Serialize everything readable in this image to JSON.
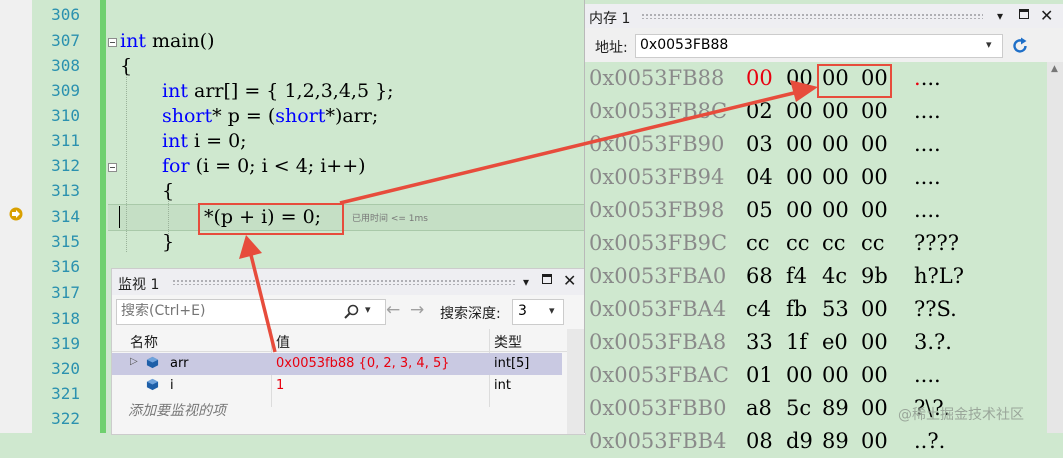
{
  "editor": {
    "line_numbers": [
      "306",
      "307",
      "308",
      "309",
      "310",
      "311",
      "312",
      "313",
      "314",
      "315",
      "316",
      "317",
      "318",
      "319",
      "320",
      "321",
      "322"
    ],
    "code_line_307": {
      "kw": "int",
      "rest": " main()"
    },
    "code_line_308": "{",
    "code_line_309": {
      "kw": "int",
      "rest": " arr[] = { 1,2,3,4,5 };"
    },
    "code_line_310": {
      "kw": "short",
      "mid": "* p = (",
      "kw2": "short",
      "rest": "*)arr;"
    },
    "code_line_311": {
      "kw": "int",
      "rest": " i = 0;"
    },
    "code_line_312": {
      "kw": "for",
      "rest": " (i = 0; i < 4; i++)"
    },
    "code_line_313": "{",
    "code_line_314": "*(p + i) = 0;",
    "code_line_315": "}",
    "elapsed_hint": "已用时间 <= 1ms"
  },
  "watch": {
    "title": "监视 1",
    "search_placeholder": "搜索(Ctrl+E)",
    "search_depth_label": "搜索深度:",
    "search_depth_value": "3",
    "columns": {
      "name": "名称",
      "value": "值",
      "type": "类型"
    },
    "rows": [
      {
        "name": "arr",
        "value": "0x0053fb88 {0, 2, 3, 4, 5}",
        "type": "int[5]"
      },
      {
        "name": "i",
        "value": "1",
        "type": "int"
      }
    ],
    "add_hint": "添加要监视的项"
  },
  "memory": {
    "title": "内存 1",
    "address_label": "地址:",
    "address_value": "0x0053FB88",
    "rows": [
      {
        "addr": "0x0053FB88",
        "bytes": [
          "00",
          "00",
          "00",
          "00"
        ],
        "chars": "...."
      },
      {
        "addr": "0x0053FB8C",
        "bytes": [
          "02",
          "00",
          "00",
          "00"
        ],
        "chars": "...."
      },
      {
        "addr": "0x0053FB90",
        "bytes": [
          "03",
          "00",
          "00",
          "00"
        ],
        "chars": "...."
      },
      {
        "addr": "0x0053FB94",
        "bytes": [
          "04",
          "00",
          "00",
          "00"
        ],
        "chars": "...."
      },
      {
        "addr": "0x0053FB98",
        "bytes": [
          "05",
          "00",
          "00",
          "00"
        ],
        "chars": "...."
      },
      {
        "addr": "0x0053FB9C",
        "bytes": [
          "cc",
          "cc",
          "cc",
          "cc"
        ],
        "chars": "????"
      },
      {
        "addr": "0x0053FBA0",
        "bytes": [
          "68",
          "f4",
          "4c",
          "9b"
        ],
        "chars": "h?L?"
      },
      {
        "addr": "0x0053FBA4",
        "bytes": [
          "c4",
          "fb",
          "53",
          "00"
        ],
        "chars": "??S."
      },
      {
        "addr": "0x0053FBA8",
        "bytes": [
          "33",
          "1f",
          "e0",
          "00"
        ],
        "chars": "3.?."
      },
      {
        "addr": "0x0053FBAC",
        "bytes": [
          "01",
          "00",
          "00",
          "00"
        ],
        "chars": "...."
      },
      {
        "addr": "0x0053FBB0",
        "bytes": [
          "a8",
          "5c",
          "89",
          "00"
        ],
        "chars": "?\\?."
      },
      {
        "addr": "0x0053FBB4",
        "bytes": [
          "08",
          "d9",
          "89",
          "00"
        ],
        "chars": "..?."
      }
    ],
    "changed_color": "#e8000f"
  },
  "watermark": "@稀土掘金技术社区",
  "colors": {
    "annotation_red": "#e74c3c",
    "keyword_blue": "#0000ff",
    "line_number_teal": "#2b91af",
    "editor_bg": "#cfe8cf"
  }
}
